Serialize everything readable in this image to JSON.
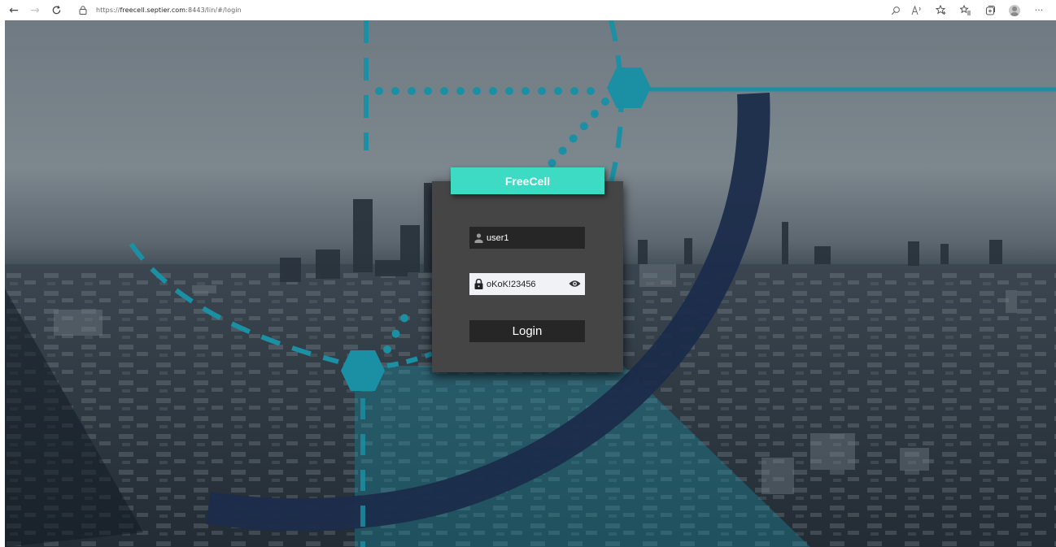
{
  "browser": {
    "url_prefix": "https://",
    "url_host": "freecell.septier.com",
    "url_rest": ":8443/lin/#/login",
    "icons": [
      "back-icon",
      "forward-icon",
      "refresh-icon",
      "lock-icon",
      "zoom-icon",
      "read-aloud-icon",
      "favorite-add-icon",
      "favorites-icon",
      "collections-icon",
      "profile-icon",
      "more-icon"
    ]
  },
  "login": {
    "title": "FreeCell",
    "username_value": "user1",
    "password_value": "oKoK!23456",
    "login_label": "Login"
  },
  "colors": {
    "brand": "#3ddbc3",
    "card": "#454545",
    "field_dark": "#262626",
    "field_light": "#f1f2f6",
    "accent_teal": "#1b8fa3",
    "accent_navy": "#1b2c4b"
  }
}
